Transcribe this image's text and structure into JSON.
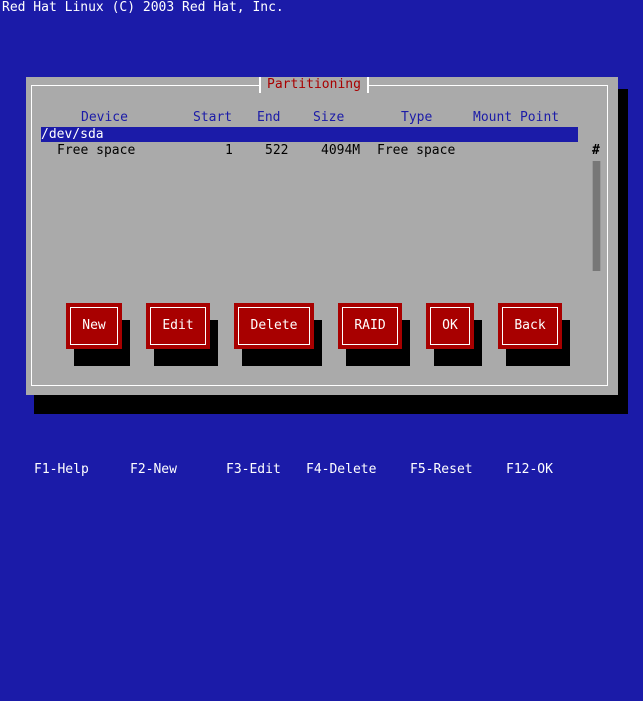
{
  "top_bar": {
    "text": "Red Hat Linux (C) 2003 Red Hat, Inc."
  },
  "dialog": {
    "title": "Partitioning",
    "columns": [
      "Device",
      "Start",
      "End",
      "Size",
      "Type",
      "Mount Point"
    ],
    "rows": [
      {
        "device": "/dev/sda",
        "start": "",
        "end": "",
        "size": "",
        "type": "",
        "mount": "",
        "selected": true
      },
      {
        "device": "Free space",
        "start": "1",
        "end": "522",
        "size": "4094M",
        "type": "Free space",
        "mount": "",
        "selected": false
      }
    ],
    "scroll_marker": "#",
    "buttons": [
      "New",
      "Edit",
      "Delete",
      "RAID",
      "OK",
      "Back"
    ]
  },
  "function_keys": [
    "F1-Help",
    "F2-New",
    "F3-Edit",
    "F4-Delete",
    "F5-Reset",
    "F12-OK"
  ],
  "colors": {
    "background": "#1b1ba8",
    "dialog": "#aaaaaa",
    "button": "#a80000",
    "title": "#a80000"
  }
}
